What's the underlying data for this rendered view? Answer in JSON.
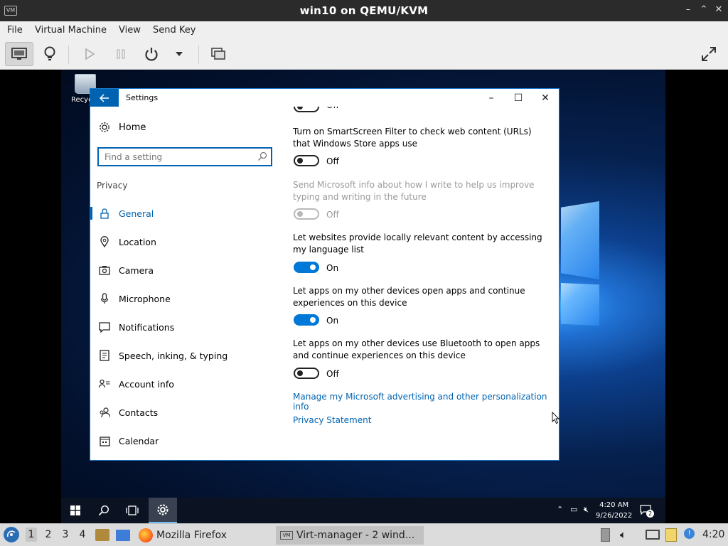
{
  "window": {
    "title": "win10 on QEMU/KVM",
    "icon_text": "VM"
  },
  "menu": [
    "File",
    "Virtual Machine",
    "View",
    "Send Key"
  ],
  "toolbar": {
    "buttons": [
      "monitor-icon",
      "lightbulb-icon",
      "play-icon",
      "pause-icon",
      "power-icon",
      "dropdown-icon",
      "screenshot-icon",
      "fullscreen-icon"
    ]
  },
  "desktop": {
    "recycle_label": "Recycle Bin"
  },
  "settings": {
    "title": "Settings",
    "home": "Home",
    "search_placeholder": "Find a setting",
    "section": "Privacy",
    "nav": [
      "General",
      "Location",
      "Camera",
      "Microphone",
      "Notifications",
      "Speech, inking, & typing",
      "Account info",
      "Contacts",
      "Calendar"
    ],
    "options": [
      {
        "text": "",
        "state": "Off",
        "on": false,
        "disabled": false
      },
      {
        "text": "Turn on SmartScreen Filter to check web content (URLs) that Windows Store apps use",
        "state": "Off",
        "on": false,
        "disabled": false
      },
      {
        "text": "Send Microsoft info about how I write to help us improve typing and writing in the future",
        "state": "Off",
        "on": false,
        "disabled": true
      },
      {
        "text": "Let websites provide locally relevant content by accessing my language list",
        "state": "On",
        "on": true,
        "disabled": false
      },
      {
        "text": "Let apps on my other devices open apps and continue experiences on this device",
        "state": "On",
        "on": true,
        "disabled": false
      },
      {
        "text": "Let apps on my other devices use Bluetooth to open apps and continue experiences on this device",
        "state": "Off",
        "on": false,
        "disabled": false
      }
    ],
    "links": [
      "Manage my Microsoft advertising and other personalization info",
      "Privacy Statement"
    ]
  },
  "guest_taskbar": {
    "time": "4:20 AM",
    "date": "9/26/2022",
    "notif_count": "2"
  },
  "host_panel": {
    "workspaces": [
      "1",
      "2",
      "3",
      "4"
    ],
    "active_workspace": "1",
    "tasks": [
      "Mozilla Firefox",
      "Virt-manager - 2 wind..."
    ],
    "clock": "4:20"
  },
  "colors": {
    "accent": "#0063b1",
    "toggle_on": "#0078d7",
    "titlebar": "#2b2b2b"
  }
}
